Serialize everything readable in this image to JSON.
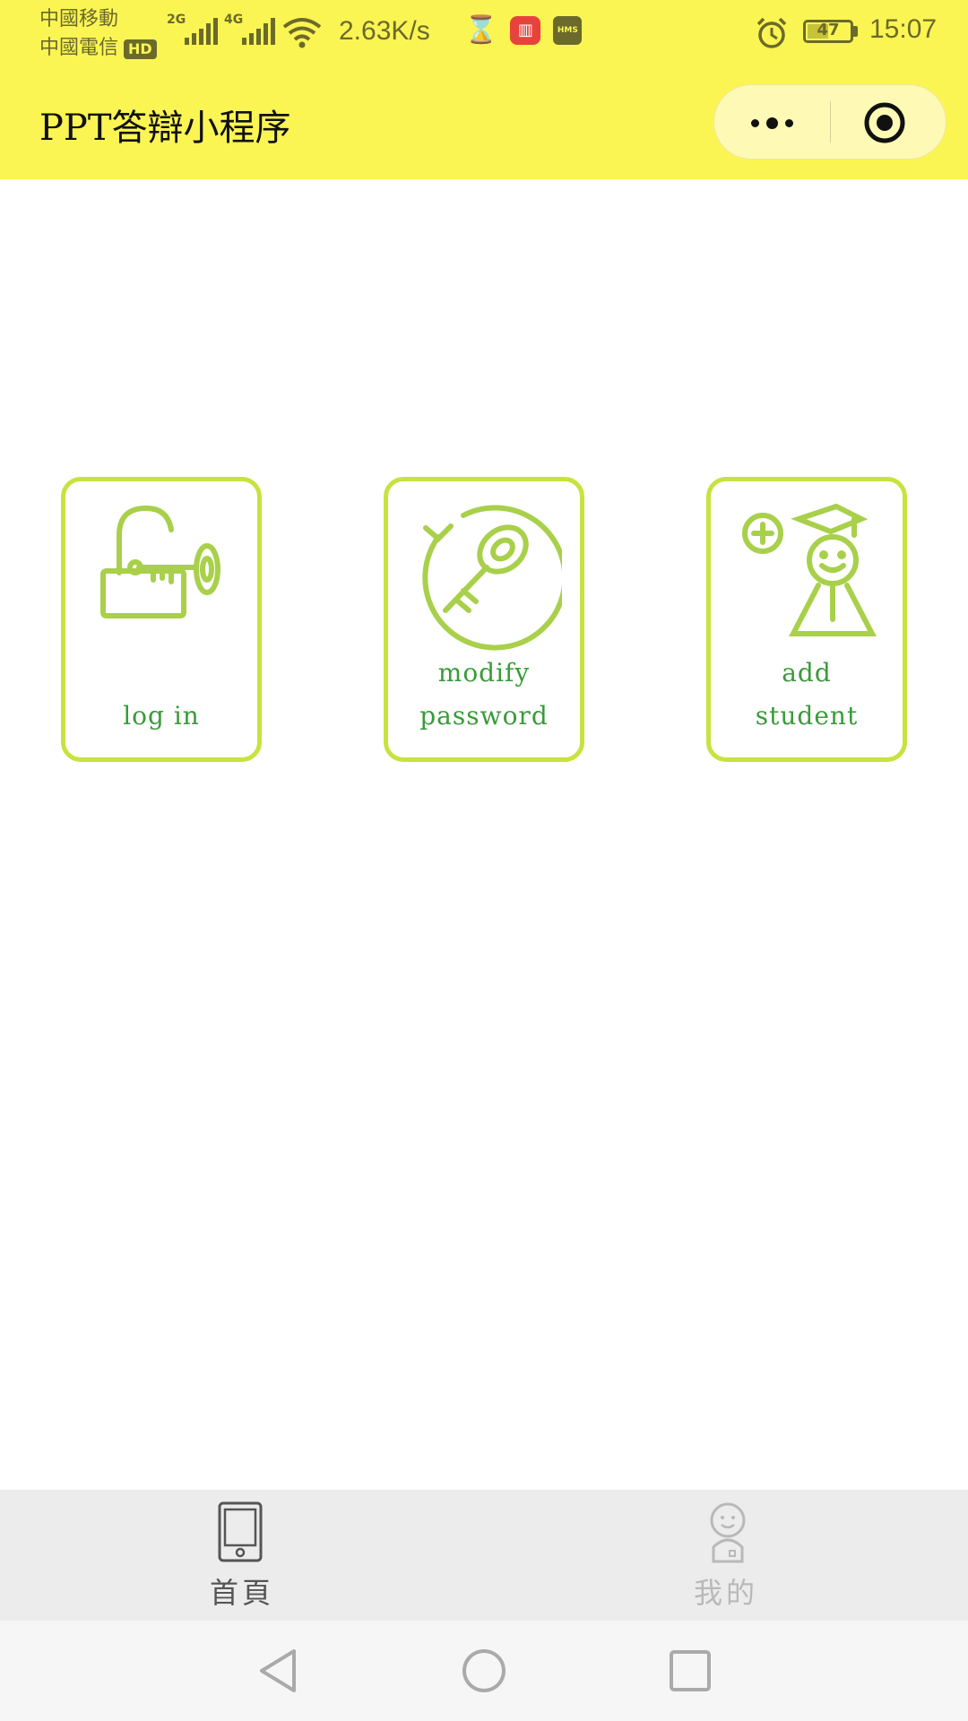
{
  "status_bar": {
    "carrier1": "中國移動",
    "carrier2": "中國電信",
    "hd_badge": "HD",
    "network1": "2G",
    "network2": "4G",
    "speed": "2.63K/s",
    "battery_level": "47",
    "time": "15:07"
  },
  "nav": {
    "title": "PPT答辯小程序"
  },
  "cards": [
    {
      "line1": "log in",
      "line2": "",
      "icon": "unlock-key-icon"
    },
    {
      "line1": "modify",
      "line2": "password",
      "icon": "key-reset-icon"
    },
    {
      "line1": "add",
      "line2": "student",
      "icon": "add-student-icon"
    }
  ],
  "tabbar": {
    "home_label": "首頁",
    "mine_label": "我的",
    "active_color": "#555555",
    "inactive_color": "#b9b9b9"
  },
  "colors": {
    "header_bg": "#fbf553",
    "card_border": "#c8e23e",
    "label_green": "#3a9a3a"
  }
}
